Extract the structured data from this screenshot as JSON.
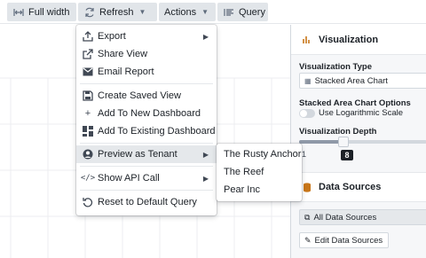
{
  "toolbar": {
    "full_width": {
      "label": "Full width",
      "icon": "expand-horizontal-icon"
    },
    "refresh": {
      "label": "Refresh",
      "icon": "refresh-icon"
    },
    "actions": {
      "label": "Actions",
      "icon": "caret-down-icon"
    },
    "query": {
      "label": "Query",
      "icon": "query-icon"
    }
  },
  "actions_menu": {
    "items": [
      {
        "label": "Export",
        "icon": "export-icon",
        "submenu": true
      },
      {
        "label": "Share View",
        "icon": "share-icon"
      },
      {
        "label": "Email Report",
        "icon": "envelope-icon"
      },
      {
        "label": "Create Saved View",
        "icon": "floppy-disk-icon"
      },
      {
        "label": "Add To New Dashboard",
        "icon": "plus-icon"
      },
      {
        "label": "Add To Existing Dashboard",
        "icon": "dashboard-icon"
      },
      {
        "label": "Preview as Tenant",
        "icon": "person-icon",
        "submenu": true,
        "active": true
      },
      {
        "label": "Show API Call",
        "icon": "code-icon",
        "submenu": true
      },
      {
        "label": "Reset to Default Query",
        "icon": "reset-icon"
      }
    ]
  },
  "tenant_submenu": {
    "items": [
      "The Rusty Anchor",
      "The Reef",
      "Pear Inc"
    ]
  },
  "visualization_panel": {
    "title": "Visualization",
    "type_label": "Visualization Type",
    "type_value": "Stacked Area Chart",
    "options_label": "Stacked Area Chart Options",
    "log_scale_label": "Use Logarithmic Scale",
    "log_scale_enabled": false,
    "depth_label": "Visualization Depth",
    "depth_min": "1",
    "depth_value": "8"
  },
  "data_sources_panel": {
    "title": "Data Sources",
    "all_sources": "All Data Sources",
    "edit_button": "Edit Data Sources"
  },
  "colors": {
    "accent_orange": "#c87619",
    "menu_active_bg": "#e5e8eb",
    "toolbar_button_bg": "#e1e5e9"
  }
}
